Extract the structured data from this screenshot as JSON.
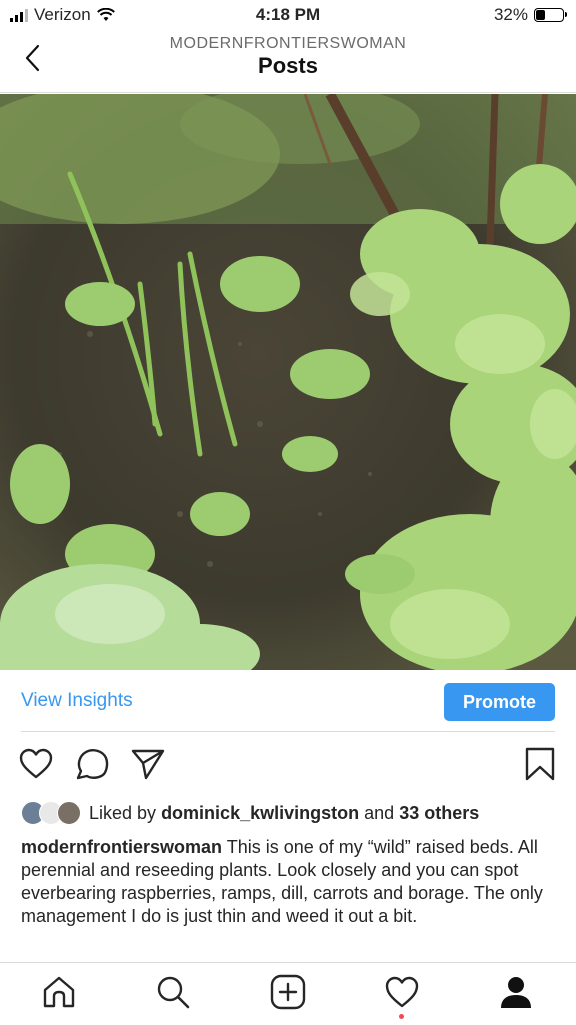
{
  "status_bar": {
    "carrier": "Verizon",
    "time": "4:18 PM",
    "battery_percent": "32%",
    "battery_level": 0.32
  },
  "header": {
    "username": "MODERNFRONTIERSWOMAN",
    "title": "Posts"
  },
  "post": {
    "image_icon": "garden-photo",
    "view_insights": "View Insights",
    "promote": "Promote",
    "liked_by_prefix": "Liked by",
    "liked_by_user": "dominick_kwlivingston",
    "liked_and": "and",
    "liked_others": "33 others",
    "caption_user": "modernfrontierswoman",
    "caption_text": "This is one of my “wild” raised beds. All perennial and reseeding plants. Look closely and you can spot everbearing raspberries, ramps, dill, carrots and borage. The only management I do is just thin and weed it out a bit."
  },
  "icons": [
    "back-chevron-icon",
    "heart-icon",
    "comment-icon",
    "share-icon",
    "bookmark-icon",
    "home-icon",
    "search-icon",
    "add-post-icon",
    "activity-heart-icon",
    "profile-icon"
  ],
  "colors": {
    "accent": "#3897f0",
    "notification": "#ed4956",
    "text": "#262626"
  }
}
